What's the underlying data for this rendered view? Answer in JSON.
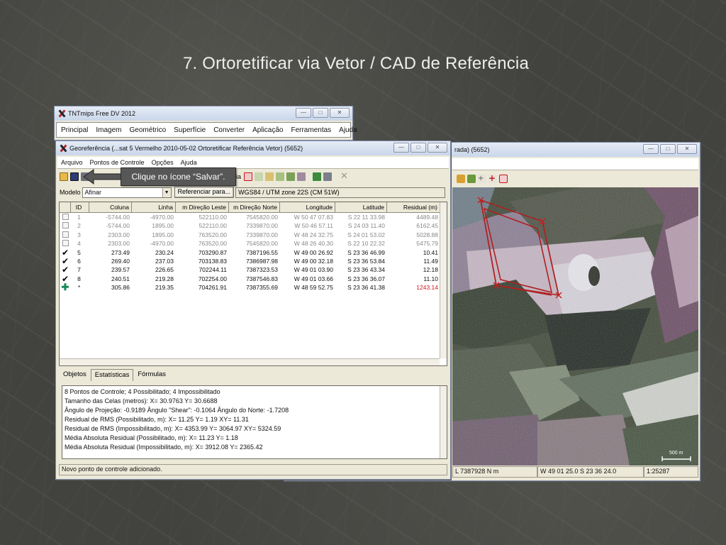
{
  "slide": {
    "title": "7. Ortoretificar via Vetor / CAD de Referência"
  },
  "callout": {
    "text": "Clique no ícone “Salvar”."
  },
  "tnt_window": {
    "title": "TNTmips Free DV 2012",
    "menu": [
      "Principal",
      "Imagem",
      "Geométrico",
      "Superfície",
      "Converter",
      "Aplicação",
      "Ferramentas",
      "Ajuda"
    ]
  },
  "map_window": {
    "title": "rada) (5652)",
    "status": {
      "northing": "L  7387928 N m",
      "latlon": "W 49 01 25.0  S 23 36 24.0",
      "scale": "1:25287"
    },
    "scale_bar_label": "500 m"
  },
  "georef_window": {
    "title": "Georeferência (...sat 5 Vermelho 2010-05-02 Ortoretificar Referência Vetor) (5652)",
    "menu": [
      "Arquivo",
      "Pontos de Controle",
      "Opções",
      "Ajuda"
    ],
    "toolbar_partial_label": "ferência",
    "model_label": "Modelo",
    "model_value": "Afinar",
    "reference_button": "Referenciar para...",
    "crs": "WGS84 / UTM zone 22S (CM 51W)",
    "columns": [
      "ID",
      "Coluna",
      "Linha",
      "m Direção Leste",
      "m Direção Norte",
      "Longitude",
      "Latitude",
      "Residual (m)"
    ],
    "rows": [
      {
        "state": "disabled",
        "id": "1",
        "coluna": "-5744.00",
        "linha": "-4970.00",
        "leste": "522110.00",
        "norte": "7545820.00",
        "lon": "W 50 47 07.83",
        "lat": "S 22 11 33.98",
        "res": "4489.48"
      },
      {
        "state": "disabled",
        "id": "2",
        "coluna": "-5744.00",
        "linha": "1895.00",
        "leste": "522110.00",
        "norte": "7339870.00",
        "lon": "W 50 46 57.11",
        "lat": "S 24 03 11.40",
        "res": "6162.45"
      },
      {
        "state": "disabled",
        "id": "3",
        "coluna": "2303.00",
        "linha": "1895.00",
        "leste": "763520.00",
        "norte": "7339870.00",
        "lon": "W 48 24 32.75",
        "lat": "S 24 01 53.02",
        "res": "5028.88"
      },
      {
        "state": "disabled",
        "id": "4",
        "coluna": "2303.00",
        "linha": "-4970.00",
        "leste": "763520.00",
        "norte": "7545820.00",
        "lon": "W 48 26 40.30",
        "lat": "S 22 10 22.32",
        "res": "5475.79"
      },
      {
        "state": "active",
        "id": "5",
        "coluna": "273.49",
        "linha": "230.24",
        "leste": "703290.87",
        "norte": "7387196.55",
        "lon": "W 49 00 26.92",
        "lat": "S 23 36 46.99",
        "res": "10.41"
      },
      {
        "state": "active",
        "id": "6",
        "coluna": "269.40",
        "linha": "237.03",
        "leste": "703138.83",
        "norte": "7386987.98",
        "lon": "W 49 00 32.18",
        "lat": "S 23 36 53.84",
        "res": "11.49"
      },
      {
        "state": "active",
        "id": "7",
        "coluna": "239.57",
        "linha": "226.65",
        "leste": "702244.11",
        "norte": "7387323.53",
        "lon": "W 49 01 03.90",
        "lat": "S 23 36 43.34",
        "res": "12.18"
      },
      {
        "state": "active",
        "id": "8",
        "coluna": "240.51",
        "linha": "219.28",
        "leste": "702254.00",
        "norte": "7387546.83",
        "lon": "W 49 01 03.66",
        "lat": "S 23 36 36.07",
        "res": "11.10"
      },
      {
        "state": "new",
        "id": "*",
        "coluna": "305.86",
        "linha": "219.35",
        "leste": "704261.91",
        "norte": "7387355.69",
        "lon": "W 48 59 52.75",
        "lat": "S 23 36 41.38",
        "res": "1243.14"
      }
    ],
    "tabs": [
      "Objetos",
      "Estatísticas",
      "Fórmulas"
    ],
    "selected_tab": "Estatísticas",
    "stats_lines": [
      "8 Pontos de Controle;  4 Possibilitado;  4 Impossibilitado",
      "Tamanho das Celas (metros):  X= 30.9763  Y= 30.6688",
      "Ângulo de Projeção: -0.9189  Ângulo \"Shear\": -0.1064  Ângulo do Norte: -1.7208",
      "Residual de RMS (Possibilitado, m):  X= 11.25  Y= 1.19  XY= 11.31",
      "Residual de RMS (Impossibilitado, m):  X= 4353.99  Y= 3064.97  XY= 5324.59",
      "Média Absoluta Residual (Possibilitado, m):  X= 11.23  Y= 1.18",
      "Média Absoluta Residual (Impossibilitado, m):  X= 3912.08  Y= 2365.42"
    ],
    "status": "Novo ponto de controle adicionado."
  },
  "colors": {
    "residual_new": "#d4141b",
    "callout_bg": "#575757",
    "window_face": "#ece9d8"
  }
}
